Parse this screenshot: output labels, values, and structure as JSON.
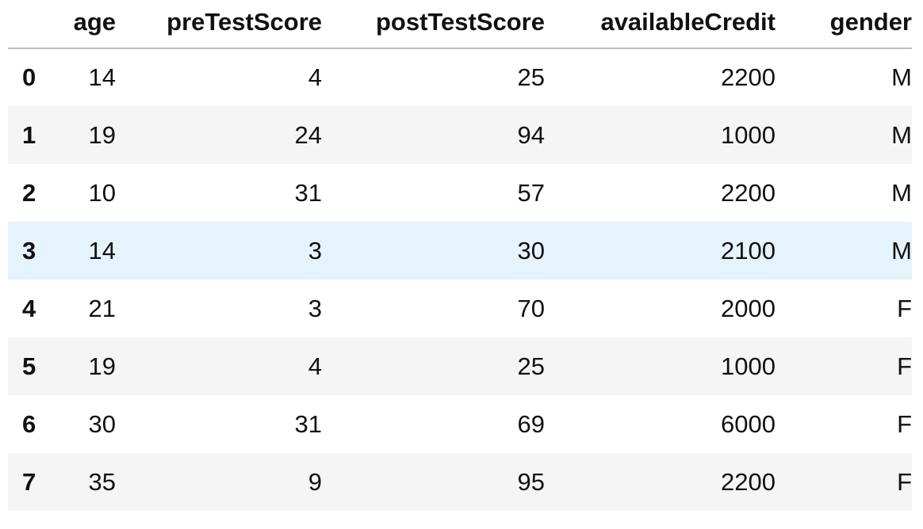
{
  "table": {
    "index_header": "",
    "columns": [
      "age",
      "preTestScore",
      "postTestScore",
      "availableCredit",
      "gender"
    ],
    "rows": [
      {
        "index": "0",
        "cells": [
          "14",
          "4",
          "25",
          "2200",
          "M"
        ]
      },
      {
        "index": "1",
        "cells": [
          "19",
          "24",
          "94",
          "1000",
          "M"
        ]
      },
      {
        "index": "2",
        "cells": [
          "10",
          "31",
          "57",
          "2200",
          "M"
        ]
      },
      {
        "index": "3",
        "cells": [
          "14",
          "3",
          "30",
          "2100",
          "M"
        ],
        "hovered": true
      },
      {
        "index": "4",
        "cells": [
          "21",
          "3",
          "70",
          "2000",
          "F"
        ]
      },
      {
        "index": "5",
        "cells": [
          "19",
          "4",
          "25",
          "1000",
          "F"
        ]
      },
      {
        "index": "6",
        "cells": [
          "30",
          "31",
          "69",
          "6000",
          "F"
        ]
      },
      {
        "index": "7",
        "cells": [
          "35",
          "9",
          "95",
          "2200",
          "F"
        ]
      }
    ]
  },
  "colors": {
    "stripe": "#f5f5f5",
    "hover": "#e6f3fc",
    "header_rule": "#bdbdbd",
    "text": "#111111"
  }
}
